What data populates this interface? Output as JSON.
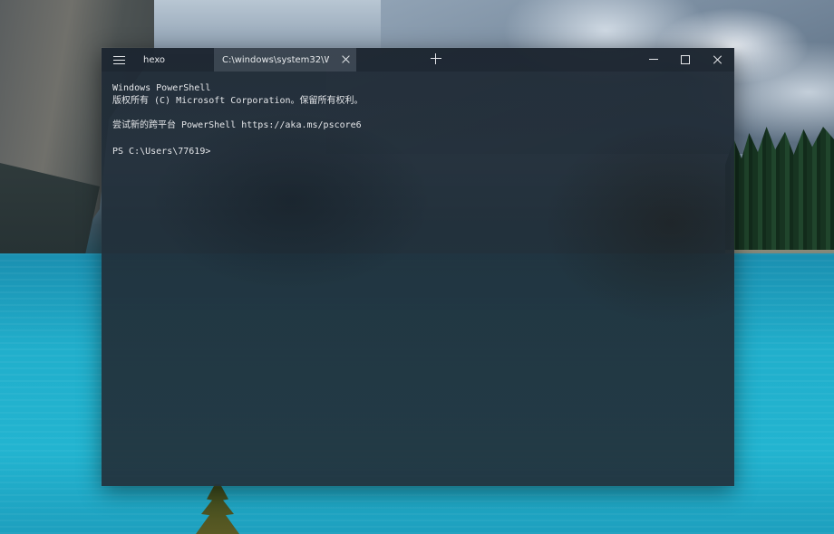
{
  "window": {
    "tabs": [
      {
        "label": "hexo",
        "active": false
      },
      {
        "label": "C:\\windows\\system32\\Win...",
        "active": true
      }
    ],
    "icons": {
      "menu": "hamburger-menu-icon",
      "tab_close": "close-icon",
      "new_tab": "plus-icon",
      "minimize": "minimize-icon",
      "maximize": "maximize-icon",
      "close": "close-icon"
    }
  },
  "terminal": {
    "lines": [
      "Windows PowerShell",
      "版权所有 (C) Microsoft Corporation。保留所有权利。",
      "",
      "尝试新的跨平台 PowerShell https://aka.ms/pscore6",
      "",
      "PS C:\\Users\\77619>"
    ]
  },
  "colors": {
    "terminal_text": "#e4e6e9",
    "terminal_background": "#212d38",
    "active_tab": "#46505c"
  }
}
